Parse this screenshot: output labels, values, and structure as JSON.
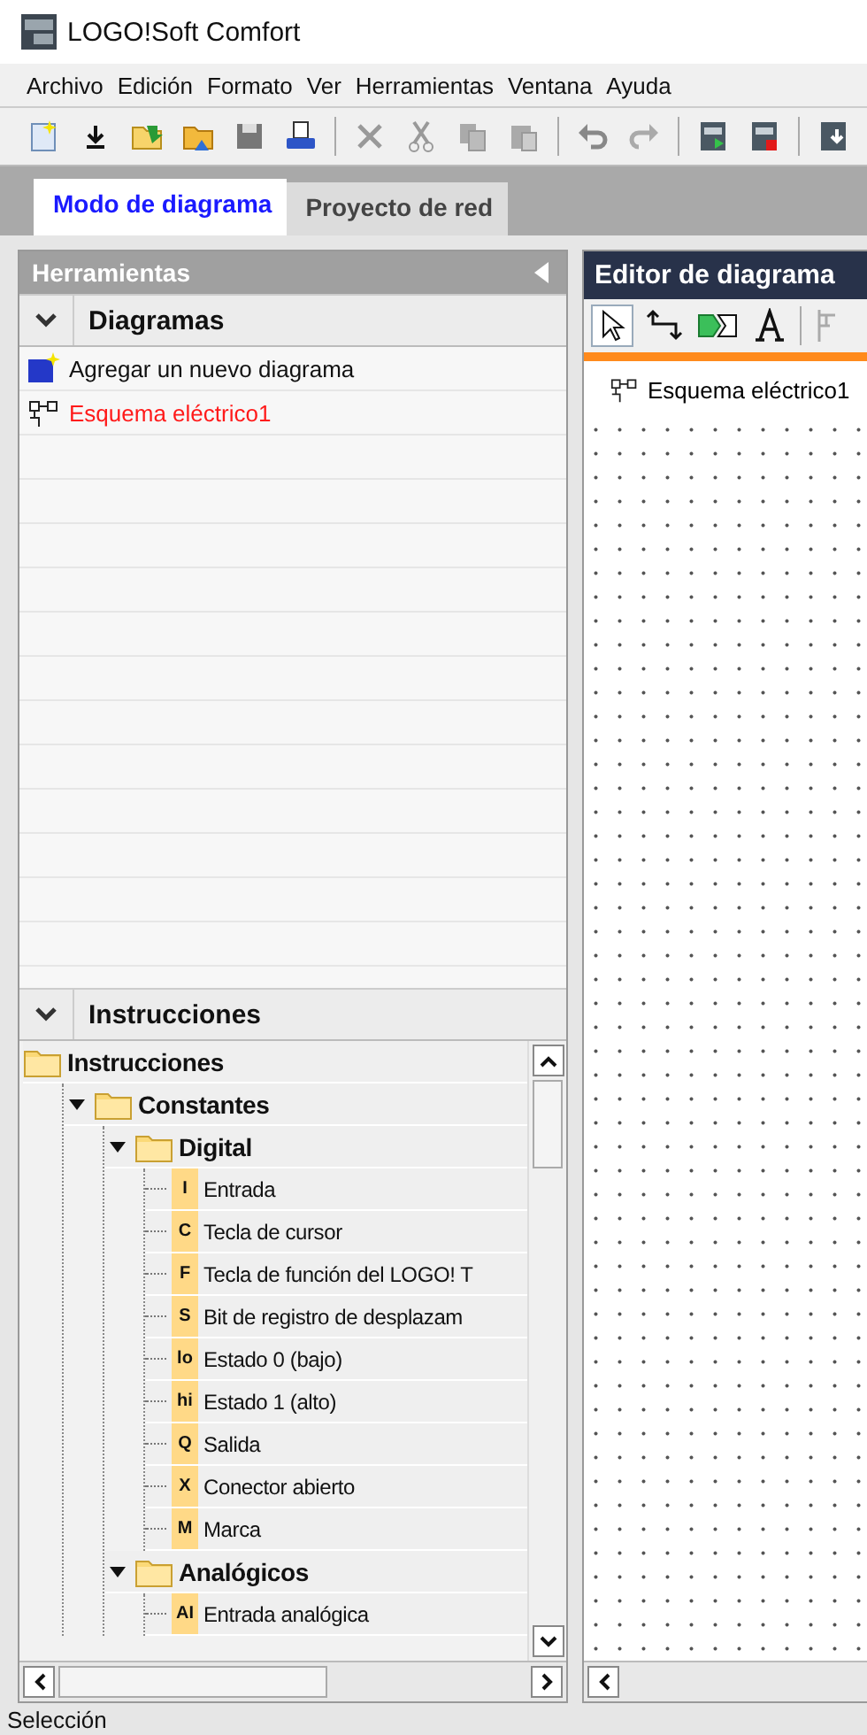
{
  "window": {
    "title": "LOGO!Soft Comfort"
  },
  "menu": [
    "Archivo",
    "Edición",
    "Formato",
    "Ver",
    "Herramientas",
    "Ventana",
    "Ayuda"
  ],
  "tabs": [
    {
      "label": "Modo de diagrama",
      "selected": true
    },
    {
      "label": "Proyecto de red",
      "selected": false
    }
  ],
  "tools_panel": {
    "title": "Herramientas",
    "diagrams": {
      "title": "Diagramas",
      "expanded": true,
      "items": [
        {
          "label": "Agregar un nuevo diagrama",
          "kind": "add",
          "active": false
        },
        {
          "label": "Esquema eléctrico1",
          "kind": "diagram",
          "active": true
        }
      ]
    },
    "instructions": {
      "title": "Instrucciones",
      "expanded": true,
      "tree": [
        {
          "label": "Instrucciones",
          "kind": "folder",
          "children": [
            {
              "label": "Constantes",
              "kind": "folder",
              "expanded": true,
              "children": [
                {
                  "label": "Digital",
                  "kind": "folder",
                  "expanded": true,
                  "children": [
                    {
                      "label": "Entrada",
                      "kind": "block",
                      "badge": "I"
                    },
                    {
                      "label": "Tecla de cursor",
                      "kind": "block",
                      "badge": "C"
                    },
                    {
                      "label": "Tecla de función del LOGO! T",
                      "kind": "block",
                      "badge": "F"
                    },
                    {
                      "label": "Bit de registro de desplazam",
                      "kind": "block",
                      "badge": "S"
                    },
                    {
                      "label": "Estado 0 (bajo)",
                      "kind": "block",
                      "badge": "lo"
                    },
                    {
                      "label": "Estado 1 (alto)",
                      "kind": "block",
                      "badge": "hi"
                    },
                    {
                      "label": "Salida",
                      "kind": "block",
                      "badge": "Q"
                    },
                    {
                      "label": "Conector abierto",
                      "kind": "block",
                      "badge": "X"
                    },
                    {
                      "label": "Marca",
                      "kind": "block",
                      "badge": "M"
                    }
                  ]
                },
                {
                  "label": "Analógicos",
                  "kind": "folder",
                  "expanded": true,
                  "children": [
                    {
                      "label": "Entrada analógica",
                      "kind": "block",
                      "badge": "AI"
                    }
                  ]
                }
              ]
            }
          ]
        }
      ]
    }
  },
  "editor": {
    "title": "Editor de diagrama",
    "tabs": [
      {
        "label": "Esquema eléctrico1",
        "selected": true
      }
    ]
  },
  "status_bar": "Selección"
}
